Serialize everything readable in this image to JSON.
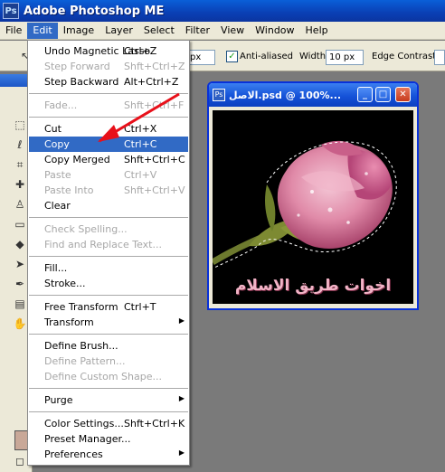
{
  "app": {
    "title": "Adobe Photoshop ME",
    "icon": "photoshop-icon"
  },
  "menubar": {
    "items": [
      "File",
      "Edit",
      "Image",
      "Layer",
      "Select",
      "Filter",
      "View",
      "Window",
      "Help"
    ],
    "active": "Edit"
  },
  "options": {
    "px_value": "px",
    "antialias_label": "Anti-aliased",
    "antialias_checked": true,
    "width_label": "Width:",
    "width_value": "10 px",
    "edge_contrast_label": "Edge Contrast:"
  },
  "edit_menu": {
    "groups": [
      [
        {
          "label": "Undo Magnetic Lasso",
          "shortcut": "Ctrl+Z",
          "enabled": true
        },
        {
          "label": "Step Forward",
          "shortcut": "Shft+Ctrl+Z",
          "enabled": false
        },
        {
          "label": "Step Backward",
          "shortcut": "Alt+Ctrl+Z",
          "enabled": true
        }
      ],
      [
        {
          "label": "Fade...",
          "shortcut": "Shft+Ctrl+F",
          "enabled": false
        }
      ],
      [
        {
          "label": "Cut",
          "shortcut": "Ctrl+X",
          "enabled": true
        },
        {
          "label": "Copy",
          "shortcut": "Ctrl+C",
          "enabled": true,
          "highlighted": true
        },
        {
          "label": "Copy Merged",
          "shortcut": "Shft+Ctrl+C",
          "enabled": true
        },
        {
          "label": "Paste",
          "shortcut": "Ctrl+V",
          "enabled": false
        },
        {
          "label": "Paste Into",
          "shortcut": "Shft+Ctrl+V",
          "enabled": false
        },
        {
          "label": "Clear",
          "shortcut": "",
          "enabled": true
        }
      ],
      [
        {
          "label": "Check Spelling...",
          "shortcut": "",
          "enabled": false
        },
        {
          "label": "Find and Replace Text...",
          "shortcut": "",
          "enabled": false
        }
      ],
      [
        {
          "label": "Fill...",
          "shortcut": "",
          "enabled": true
        },
        {
          "label": "Stroke...",
          "shortcut": "",
          "enabled": true
        }
      ],
      [
        {
          "label": "Free Transform",
          "shortcut": "Ctrl+T",
          "enabled": true
        },
        {
          "label": "Transform",
          "shortcut": "",
          "enabled": true,
          "submenu": true
        }
      ],
      [
        {
          "label": "Define Brush...",
          "shortcut": "",
          "enabled": true
        },
        {
          "label": "Define Pattern...",
          "shortcut": "",
          "enabled": false
        },
        {
          "label": "Define Custom Shape...",
          "shortcut": "",
          "enabled": false
        }
      ],
      [
        {
          "label": "Purge",
          "shortcut": "",
          "enabled": true,
          "submenu": true
        }
      ],
      [
        {
          "label": "Color Settings...",
          "shortcut": "Shft+Ctrl+K",
          "enabled": true
        },
        {
          "label": "Preset Manager...",
          "shortcut": "",
          "enabled": true
        },
        {
          "label": "Preferences",
          "shortcut": "",
          "enabled": true,
          "submenu": true
        }
      ]
    ]
  },
  "document": {
    "title": "الاصل.psd @ 100%...",
    "watermark": "اخوات طريق الاسلام",
    "buttons": [
      "minimize-icon",
      "maximize-icon",
      "close-icon"
    ]
  },
  "colors": {
    "titlebar": "#0a4fd0",
    "menu_highlight": "#316ac5",
    "arrow": "#e8101a",
    "rose": "#d86a93",
    "canvas_bg": "#000000"
  }
}
